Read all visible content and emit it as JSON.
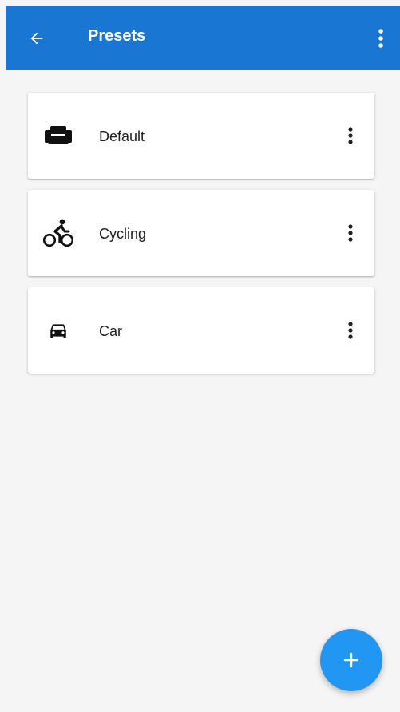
{
  "app_bar": {
    "title": "Presets",
    "back_icon": "arrow-back-icon",
    "overflow_icon": "more-vert-icon",
    "color": "#1976d2"
  },
  "presets": [
    {
      "label": "Default",
      "icon": "sofa-icon"
    },
    {
      "label": "Cycling",
      "icon": "cyclist-icon"
    },
    {
      "label": "Car",
      "icon": "car-icon"
    }
  ],
  "fab": {
    "icon": "plus-icon",
    "color": "#2196f3"
  }
}
